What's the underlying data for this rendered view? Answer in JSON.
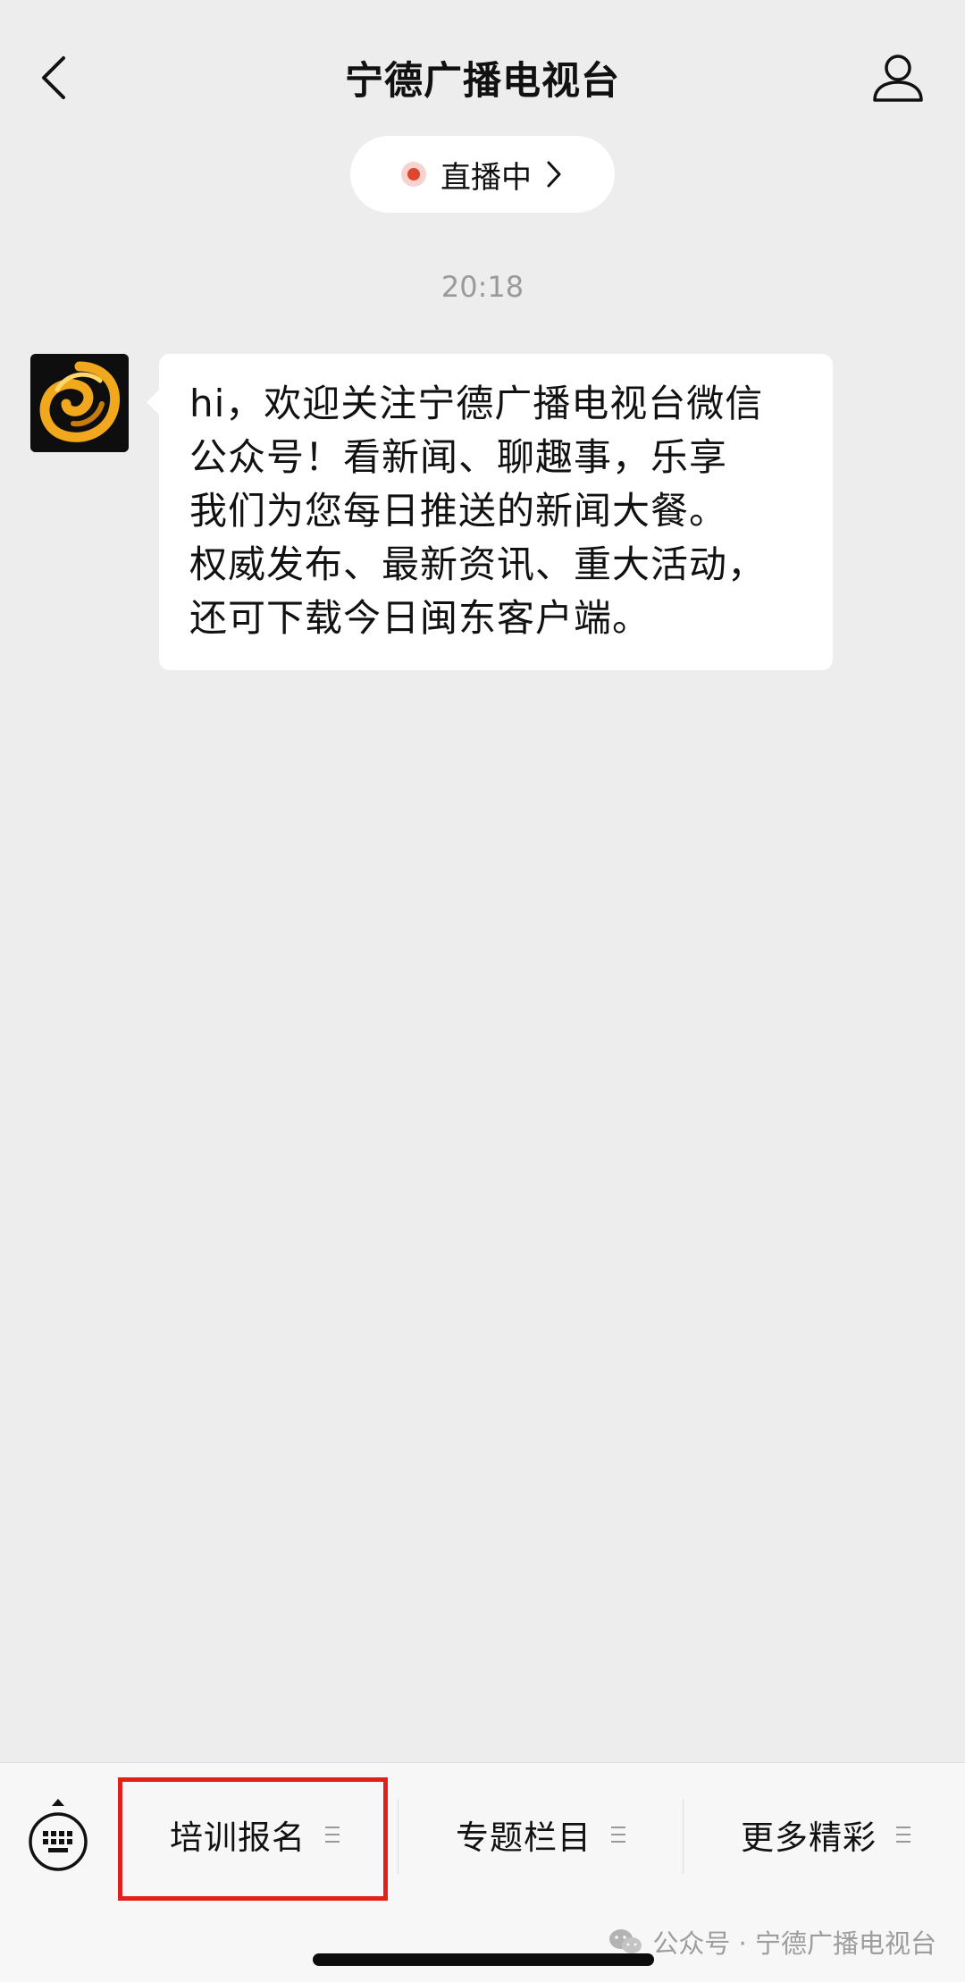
{
  "header": {
    "title": "宁德广播电视台"
  },
  "live": {
    "label": "直播中"
  },
  "chat": {
    "timestamp": "20:18",
    "message_lines": [
      "hi，欢迎关注宁德广播电视台微信",
      "公众号！看新闻、聊趣事，乐享",
      "我们为您每日推送的新闻大餐。",
      "权威发布、最新资讯、重大活动，",
      "还可下载今日闽东客户端。"
    ]
  },
  "menu": {
    "items": [
      {
        "label": "培训报名"
      },
      {
        "label": "专题栏目"
      },
      {
        "label": "更多精彩"
      }
    ]
  },
  "watermark": {
    "text": "公众号 · 宁德广播电视台"
  },
  "colors": {
    "background": "#ededed",
    "bubble": "#ffffff",
    "live_dot": "#e0452e",
    "highlight": "#e0201a",
    "avatar_gold": "#f2a81d"
  },
  "icons": [
    "back-arrow-icon",
    "profile-icon",
    "live-dot-icon",
    "chevron-right-icon",
    "keyboard-icon",
    "menu-lines-icon",
    "wechat-icon"
  ]
}
